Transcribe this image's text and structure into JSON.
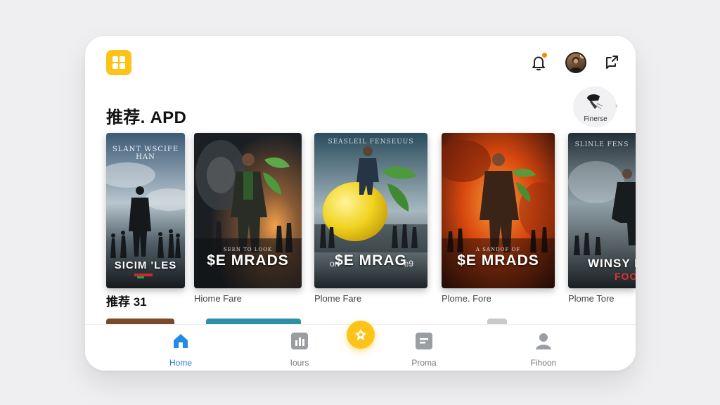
{
  "header": {
    "logo_icon": "grid-icon",
    "accent_color": "#fcc419",
    "notification_icon": "bell-icon",
    "profile_icon": "avatar",
    "share_icon": "share-icon"
  },
  "section": {
    "title": "推荐. APD",
    "filter_label": "Finerse"
  },
  "posters": [
    {
      "top": "SLANT WSCIFE HAN",
      "title": "SICIM 'LES",
      "sub": "",
      "caption": "推荐 31",
      "caption_cn": true
    },
    {
      "top": "",
      "title": "$E MRADS",
      "sub": "SEEN TO LOOK",
      "caption": "Hiome Fare",
      "caption_cn": false
    },
    {
      "top": "SEASLEIL FENSEUUS",
      "title": "$E MRAG",
      "sub": "",
      "caption": "Plome Fare",
      "caption_cn": false
    },
    {
      "top": "",
      "title": "$E MRADS",
      "sub": "A SANDOF OF",
      "caption": "Plome. Fore",
      "caption_cn": false
    },
    {
      "top": "SLINLE FENS",
      "title": "WINSY BA",
      "sub": "FOOA",
      "caption": "Plome Tore",
      "caption_cn": false
    }
  ],
  "poster_overlay": {
    "left": "on",
    "right": "e9"
  },
  "nav": {
    "items": [
      {
        "label": "Home",
        "icon": "home-icon",
        "active": true
      },
      {
        "label": "Iours",
        "icon": "chart-icon",
        "active": false
      },
      {
        "label": "",
        "icon": "center-action-icon",
        "active": false
      },
      {
        "label": "Proma",
        "icon": "card-icon",
        "active": false
      },
      {
        "label": "Fihoon",
        "icon": "person-icon",
        "active": false
      }
    ]
  }
}
